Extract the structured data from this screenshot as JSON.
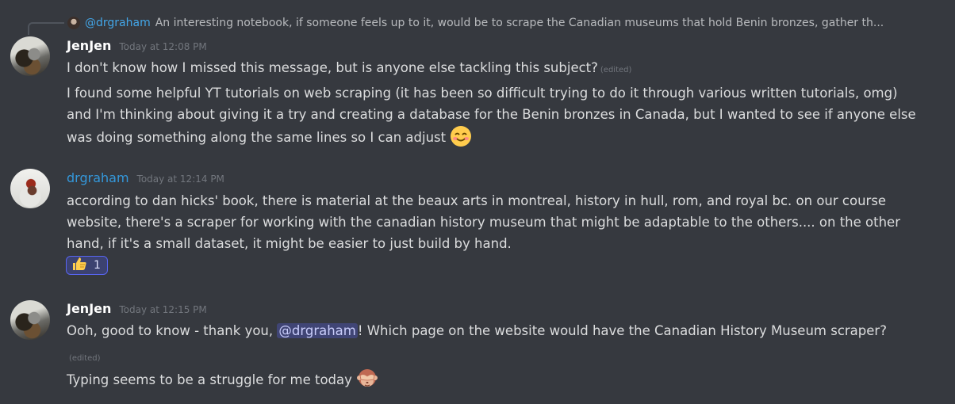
{
  "reply": {
    "mention": "@drgraham",
    "text": "An interesting notebook, if someone feels up to it, would be to scrape the Canadian museums that hold Benin bronzes, gather th..."
  },
  "messages": [
    {
      "author": "JenJen",
      "timestamp": "Today at 12:08 PM",
      "paragraphs": [
        {
          "text": "I don't know how I missed this message, but is anyone else tackling this subject?",
          "edited": "(edited)"
        },
        {
          "text": "I found some helpful YT tutorials on web scraping (it has been so difficult trying to do it through various written tutorials, omg) and I'm thinking about giving it a try and creating a database for the Benin bronzes in Canada, but I wanted to see if anyone else was doing something along the same lines so I can adjust",
          "emoji": "smiling-face-emoji"
        }
      ]
    },
    {
      "author": "drgraham",
      "timestamp": "Today at 12:14 PM",
      "text": "according to dan hicks' book, there is material at the beaux arts in montreal, history in hull, rom, and royal bc. on our course website, there's a scraper for working with the canadian history museum that might be adaptable to the others.... on the other hand, if it's a small dataset, it might be easier to just build by hand.",
      "reaction": {
        "emoji": "thumbs-up-emoji",
        "count": "1"
      }
    },
    {
      "author": "JenJen",
      "timestamp": "Today at 12:15 PM",
      "text_before": "Ooh, good to know - thank you,",
      "mention": "@drgraham",
      "text_after": "! Which page on the website would have the Canadian History Museum scraper?",
      "edited": "(edited)",
      "followup": "Typing seems to be a struggle for me today",
      "followup_emoji": "see-no-evil-monkey-emoji"
    }
  ],
  "colors": {
    "background": "#36393f",
    "text": "#dcddde",
    "timestamp": "#72767d",
    "link_blue": "#3498db",
    "mention_bg": "#414675"
  }
}
